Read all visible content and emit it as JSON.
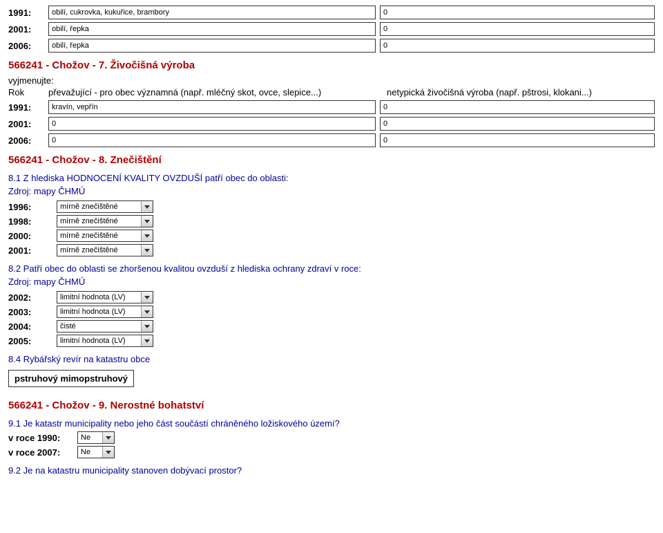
{
  "crops": {
    "rows": [
      {
        "year": "1991:",
        "text": "obilí, cukrovka, kukuřice, brambory",
        "val": "0"
      },
      {
        "year": "2001:",
        "text": "obilí, řepka",
        "val": "0"
      },
      {
        "year": "2006:",
        "text": "obilí, řepka",
        "val": "0"
      }
    ]
  },
  "section7": {
    "title": "566241 - Chožov - 7. Živočišná výroba",
    "instr1": "vyjmenujte:",
    "col1": "Rok",
    "col2": "převažující - pro obec významná (např. mléčný skot, ovce, slepice...)",
    "col3": "netypická živočišná výroba (např. pštrosi, klokani...)",
    "rows": [
      {
        "year": "1991:",
        "text": "kravín, vepřín",
        "val": "0"
      },
      {
        "year": "2001:",
        "text": "0",
        "val": "0"
      },
      {
        "year": "2006:",
        "text": "0",
        "val": "0"
      }
    ]
  },
  "section8": {
    "title": "566241 - Chožov - 8. Znečištění",
    "q1": "8.1 Z hlediska HODNOCENÍ KVALITY OVZDUŠÍ patří obec do oblasti:",
    "src": "Zdroj: mapy ČHMÚ",
    "rows1": [
      {
        "year": "1996:",
        "val": "mírně znečištěné"
      },
      {
        "year": "1998:",
        "val": "mírně znečištěné"
      },
      {
        "year": "2000:",
        "val": "mírně znečištěné"
      },
      {
        "year": "2001:",
        "val": "mírně znečištěné"
      }
    ],
    "q2": "8.2 Patří obec do oblasti se zhoršenou kvalitou ovzduší z hlediska ochrany zdraví v roce:",
    "rows2": [
      {
        "year": "2002:",
        "val": "limitní hodnota (LV)"
      },
      {
        "year": "2003:",
        "val": "limitní hodnota (LV)"
      },
      {
        "year": "2004:",
        "val": "čisté"
      },
      {
        "year": "2005:",
        "val": "limitní hodnota (LV)"
      }
    ],
    "q4": "8.4 Rybářský revír na katastru obce",
    "fishing": "pstruhový   mimopstruhový"
  },
  "section9": {
    "title": "566241 - Chožov - 9. Nerostné bohatství",
    "q1": "9.1 Je katastr municipality nebo jeho část součástí chráněného ložiskového území?",
    "rows": [
      {
        "year": "v roce 1990:",
        "val": "Ne"
      },
      {
        "year": "v roce 2007:",
        "val": "Ne"
      }
    ],
    "q2": "9.2 Je na katastru municipality stanoven dobývací prostor?"
  }
}
